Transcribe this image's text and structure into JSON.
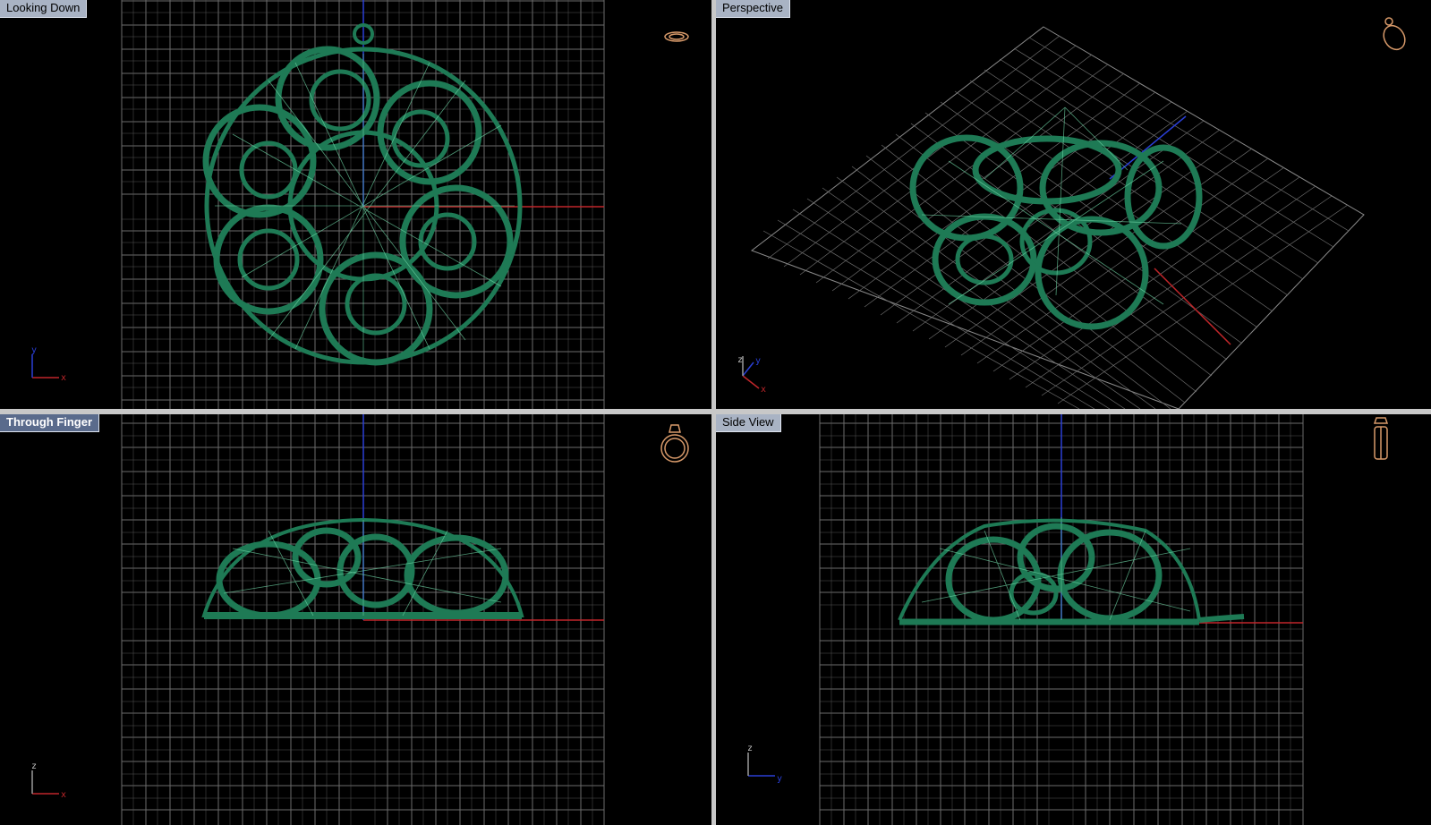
{
  "viewports": {
    "top": {
      "label": "Looking Down",
      "axis_h": "x",
      "axis_v": "y",
      "active": false
    },
    "perspective": {
      "label": "Perspective",
      "axis_h": "x",
      "axis_v": "y",
      "axis_z": "z",
      "active": false
    },
    "front": {
      "label": "Through Finger",
      "axis_h": "x",
      "axis_v": "z",
      "active": true
    },
    "side": {
      "label": "Side View",
      "axis_h": "y",
      "axis_v": "z",
      "active": false
    }
  },
  "icons": {
    "top": "ring-top-view-icon",
    "perspective": "ring-perspective-icon",
    "front": "ring-front-view-icon",
    "side": "ring-side-view-icon"
  },
  "colors": {
    "viewport_bg": "#000000",
    "grid": "#7a7a7a",
    "model": "#1e7a55",
    "model_highlight": "#6fd6a6",
    "x_axis": "#c0262a",
    "y_axis": "#2a3fd6",
    "active_tab": "#5a6b8c",
    "tab": "#a9b3c4",
    "icon": "#d89a6a"
  }
}
